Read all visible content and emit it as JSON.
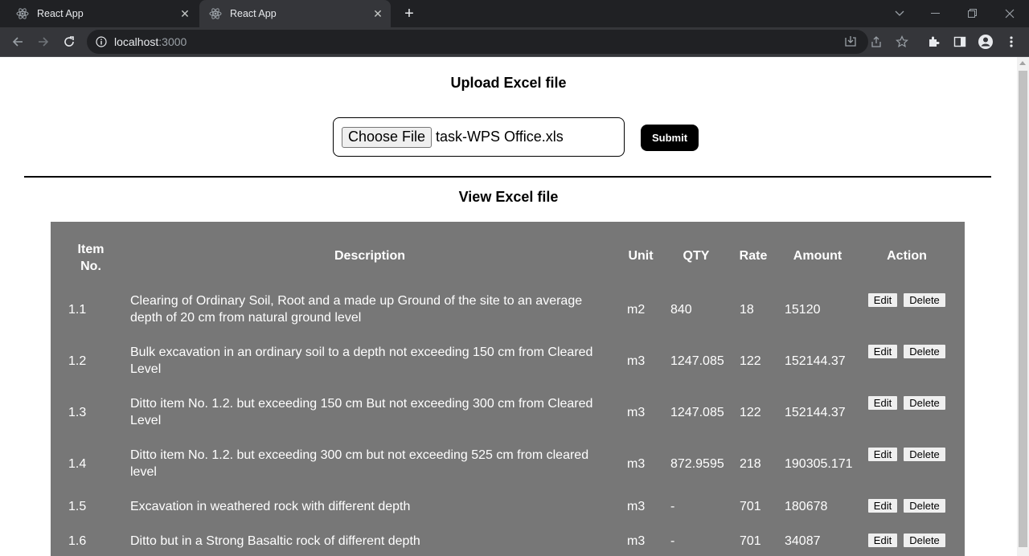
{
  "browser": {
    "tabs": [
      {
        "title": "React App"
      },
      {
        "title": "React App"
      }
    ],
    "url_host": "localhost",
    "url_port": ":3000"
  },
  "page": {
    "upload_heading": "Upload Excel file",
    "choose_file_label": "Choose File",
    "file_name": "task-WPS Office.xls",
    "submit_label": "Submit",
    "view_heading": "View Excel file"
  },
  "table": {
    "headers": {
      "item_line1": "Item",
      "item_line2": "No.",
      "description": "Description",
      "unit": "Unit",
      "qty": "QTY",
      "rate": "Rate",
      "amount": "Amount",
      "action": "Action"
    },
    "edit_label": "Edit",
    "delete_label": "Delete",
    "rows": [
      {
        "item": "1.1",
        "description": "Clearing of Ordinary Soil, Root and a made up Ground of the site to an average depth of 20 cm from natural ground level",
        "unit": "m2",
        "qty": "840",
        "rate": "18",
        "amount": "15120"
      },
      {
        "item": "1.2",
        "description": "Bulk excavation in an ordinary soil to a depth not exceeding 150 cm from Cleared Level",
        "unit": "m3",
        "qty": "1247.085",
        "rate": "122",
        "amount": "152144.37"
      },
      {
        "item": "1.3",
        "description": "Ditto item No. 1.2. but exceeding 150 cm But not exceeding 300 cm from Cleared Level",
        "unit": "m3",
        "qty": "1247.085",
        "rate": "122",
        "amount": "152144.37"
      },
      {
        "item": "1.4",
        "description": "Ditto item No. 1.2. but exceeding 300 cm but not exceeding 525 cm from cleared level",
        "unit": "m3",
        "qty": "872.9595",
        "rate": "218",
        "amount": "190305.171"
      },
      {
        "item": "1.5",
        "description": "Excavation in weathered rock with different depth",
        "unit": "m3",
        "qty": "-",
        "rate": "701",
        "amount": "180678"
      },
      {
        "item": "1.6",
        "description": "Ditto but in a Strong Basaltic rock of different depth",
        "unit": "m3",
        "qty": "-",
        "rate": "701",
        "amount": "34087"
      }
    ]
  },
  "colors": {
    "table_bg": "#777777",
    "chrome_dark": "#202124",
    "chrome_toolbar": "#35363a"
  }
}
